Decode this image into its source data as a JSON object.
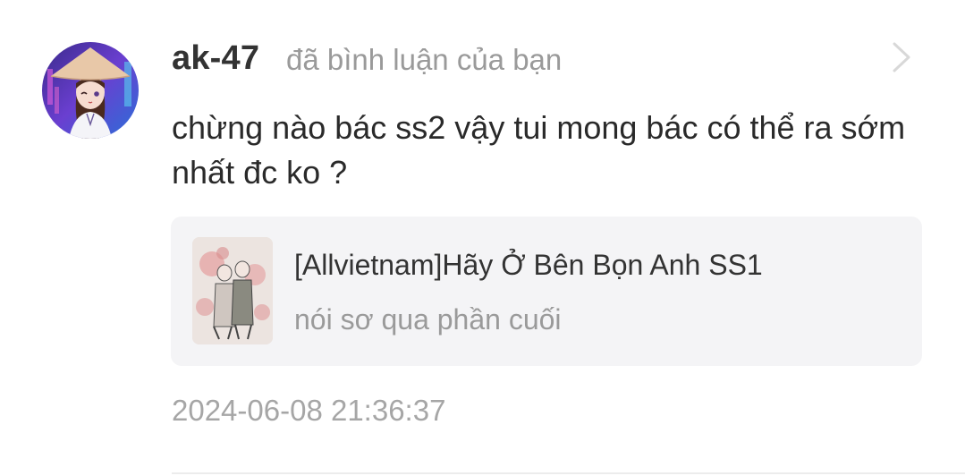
{
  "notification": {
    "user": {
      "name": "ak-47",
      "avatar_icon": "user-avatar"
    },
    "action_text": "đã bình luận của bạn",
    "comment": "chừng nào bác ss2 vậy tui mong bác có thể ra sớm nhất đc ko ?",
    "post": {
      "title": "[Allvietnam]Hãy Ở Bên Bọn Anh SS1",
      "subtitle": "nói sơ qua phần cuối",
      "thumbnail_icon": "story-cover-thumbnail"
    },
    "timestamp": "2024-06-08 21:36:37",
    "chevron_icon": "chevron-right-icon"
  },
  "colors": {
    "username": "#333333",
    "secondary_text": "#9a9a9a",
    "card_background": "#f4f4f6",
    "chevron": "#d8d8d8"
  }
}
